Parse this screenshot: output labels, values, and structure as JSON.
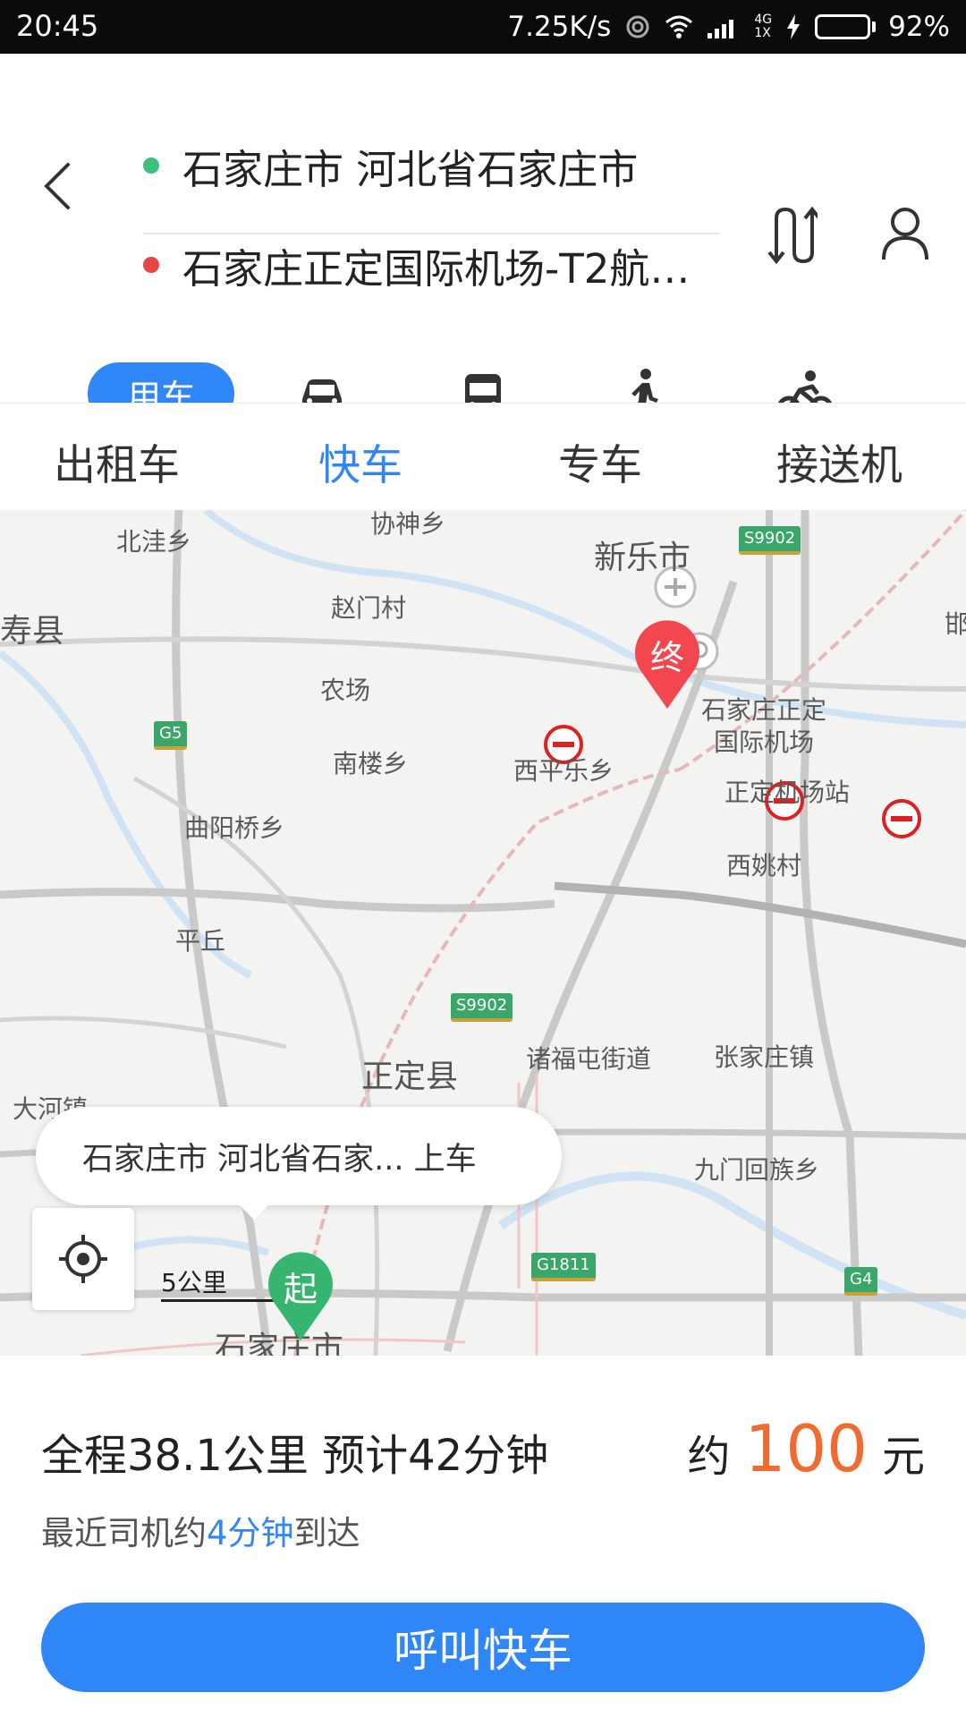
{
  "status_bar": {
    "time": "20:45",
    "net_speed": "7.25K/s",
    "network_type": "4G",
    "sim": "1X",
    "battery": "92%",
    "battery_level": 0.92
  },
  "route": {
    "start": "石家庄市 河北省石家庄市",
    "end": "石家庄正定国际机场-T2航…",
    "start_color": "#3cc07a",
    "end_color": "#e84545"
  },
  "modes": {
    "active_label": "用车",
    "icons": [
      "car-icon",
      "bus-icon",
      "walk-icon",
      "bike-icon"
    ]
  },
  "tabs": [
    "出租车",
    "快车",
    "专车",
    "接送机"
  ],
  "active_tab": 1,
  "map": {
    "place_labels": [
      "北洼乡",
      "协神乡",
      "新乐市",
      "赵门村",
      "寿县",
      "农场",
      "石家庄正定",
      "国际机场",
      "南楼乡",
      "西平乐乡",
      "正定机场站",
      "曲阳桥乡",
      "西姚村",
      "平丘",
      "诸福屯街道",
      "张家庄镇",
      "正定县",
      "大河镇",
      "九门回族乡",
      "石家庄市",
      "邯"
    ],
    "road_shields": [
      "S9902",
      "G5",
      "S9902",
      "G1811",
      "G4"
    ],
    "end_marker": "终",
    "start_marker": "起",
    "callout": "石家庄市 河北省石家... 上车",
    "scale": "5公里"
  },
  "trip": {
    "summary": "全程38.1公里 预计42分钟",
    "price_prefix": "约",
    "price": "100",
    "price_unit": "元",
    "eta_prefix": "最近司机约",
    "eta_time": "4分钟",
    "eta_suffix": "到达"
  },
  "cta": {
    "label": "呼叫快车",
    "color": "#2f86f6"
  }
}
